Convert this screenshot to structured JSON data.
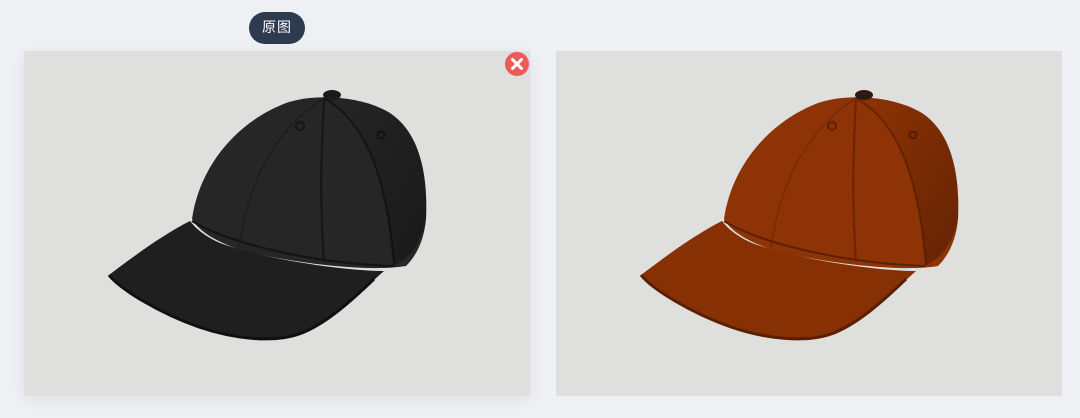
{
  "compare": {
    "original_label": "原图"
  },
  "colors": {
    "page_background": "#eef0f4",
    "image_background": "#dfdfde",
    "label_background": "#2e3a4e",
    "close_button": "#ee5a55",
    "cap_original": "#222222",
    "cap_recolored": "#8a3104"
  },
  "images": {
    "original": {
      "subject": "baseball-cap",
      "color_name": "black"
    },
    "result": {
      "subject": "baseball-cap",
      "color_name": "rust-orange"
    }
  },
  "icons": {
    "close": "close-icon"
  }
}
